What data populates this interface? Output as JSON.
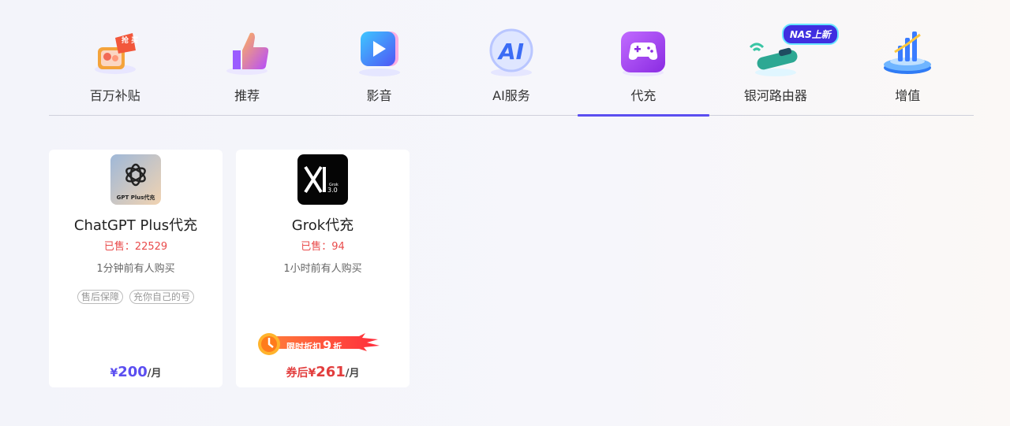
{
  "tabs": [
    {
      "label": "百万补贴",
      "icon": "gift-basket-icon",
      "badge": "抢 买"
    },
    {
      "label": "推荐",
      "icon": "thumbs-up-icon"
    },
    {
      "label": "影音",
      "icon": "play-icon"
    },
    {
      "label": "AI服务",
      "icon": "ai-icon"
    },
    {
      "label": "代充",
      "icon": "gamepad-icon"
    },
    {
      "label": "银河路由器",
      "icon": "router-icon",
      "badge": "NAS上新"
    },
    {
      "label": "增值",
      "icon": "bar-chart-icon"
    }
  ],
  "active_tab": "代充",
  "colors": {
    "accent": "#5b4ef0",
    "sale_red": "#e94b4b",
    "price_red": "#e23d3d"
  },
  "products": [
    {
      "title": "ChatGPT Plus代充",
      "logo_text": "GPT Plus代充",
      "sold_label": "已售：",
      "sold_count": "22529",
      "recent": "1分钟前有人购买",
      "tags": [
        "售后保障",
        "充你自己的号"
      ],
      "price_symbol": "¥",
      "price": "200",
      "unit": "/月"
    },
    {
      "title": "Grok代充",
      "logo_text": "3.0",
      "logo_small": "Grok",
      "sold_label": "已售：",
      "sold_count": "94",
      "recent": "1小时前有人购买",
      "promo_label": "限时折扣",
      "promo_value": "9",
      "promo_unit": "折",
      "price_prefix": "券后",
      "price_symbol": "¥",
      "price": "261",
      "unit": "/月"
    }
  ]
}
